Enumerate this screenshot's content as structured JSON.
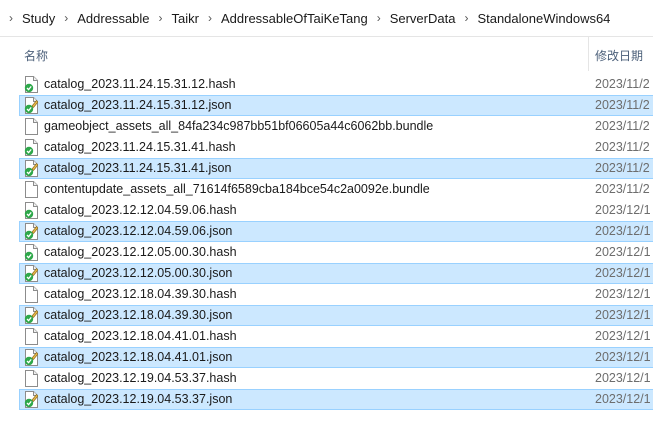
{
  "breadcrumb": [
    "Study",
    "Addressable",
    "Taikr",
    "AddressableOfTaiKeTang",
    "ServerData",
    "StandaloneWindows64"
  ],
  "columns": {
    "name": "名称",
    "date": "修改日期"
  },
  "files": [
    {
      "name": "catalog_2023.11.24.15.31.12.hash",
      "date": "2023/11/2",
      "icon": "hash-file-icon",
      "selected": false
    },
    {
      "name": "catalog_2023.11.24.15.31.12.json",
      "date": "2023/11/2",
      "icon": "json-file-icon",
      "selected": true
    },
    {
      "name": "gameobject_assets_all_84fa234c987bb51bf06605a44c6062bb.bundle",
      "date": "2023/11/2",
      "icon": "bundle-file-icon",
      "selected": false
    },
    {
      "name": "catalog_2023.11.24.15.31.41.hash",
      "date": "2023/11/2",
      "icon": "hash-file-icon",
      "selected": false
    },
    {
      "name": "catalog_2023.11.24.15.31.41.json",
      "date": "2023/11/2",
      "icon": "json-file-icon",
      "selected": true
    },
    {
      "name": "contentupdate_assets_all_71614f6589cba184bce54c2a0092e.bundle",
      "date": "2023/11/2",
      "icon": "bundle-file-icon",
      "selected": false
    },
    {
      "name": "catalog_2023.12.12.04.59.06.hash",
      "date": "2023/12/1",
      "icon": "hash-file-icon",
      "selected": false
    },
    {
      "name": "catalog_2023.12.12.04.59.06.json",
      "date": "2023/12/1",
      "icon": "json-file-icon",
      "selected": true
    },
    {
      "name": "catalog_2023.12.12.05.00.30.hash",
      "date": "2023/12/1",
      "icon": "hash-file-icon",
      "selected": false
    },
    {
      "name": "catalog_2023.12.12.05.00.30.json",
      "date": "2023/12/1",
      "icon": "json-file-icon",
      "selected": true
    },
    {
      "name": "catalog_2023.12.18.04.39.30.hash",
      "date": "2023/12/1",
      "icon": "plain-file-icon",
      "selected": false
    },
    {
      "name": "catalog_2023.12.18.04.39.30.json",
      "date": "2023/12/1",
      "icon": "json-file-icon",
      "selected": true
    },
    {
      "name": "catalog_2023.12.18.04.41.01.hash",
      "date": "2023/12/1",
      "icon": "plain-file-icon",
      "selected": false
    },
    {
      "name": "catalog_2023.12.18.04.41.01.json",
      "date": "2023/12/1",
      "icon": "json-file-icon",
      "selected": true
    },
    {
      "name": "catalog_2023.12.19.04.53.37.hash",
      "date": "2023/12/1",
      "icon": "plain-file-icon",
      "selected": false
    },
    {
      "name": "catalog_2023.12.19.04.53.37.json",
      "date": "2023/12/1",
      "icon": "json-file-icon",
      "selected": true
    }
  ],
  "colors": {
    "selection": "#cce8ff",
    "selection_border": "#99d1ff",
    "header_text": "#4c607a",
    "date_text": "#6d6d6d"
  }
}
